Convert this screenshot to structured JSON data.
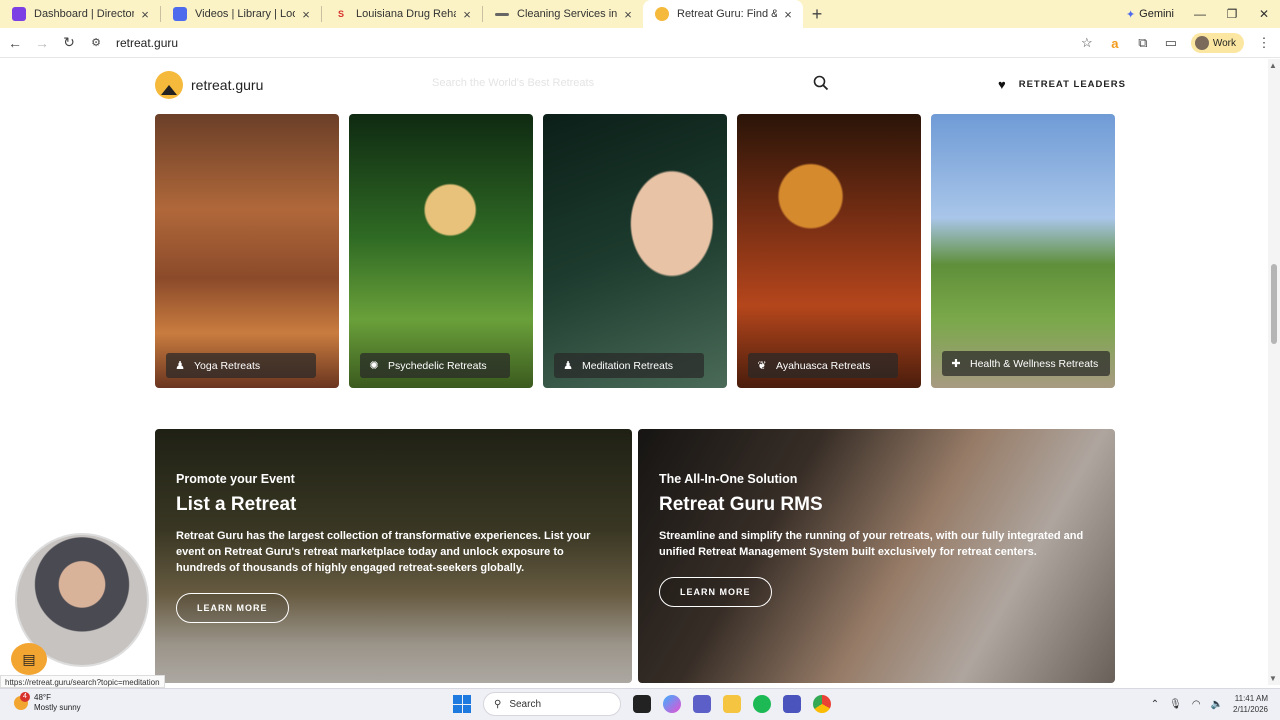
{
  "browser": {
    "tabs": [
      {
        "title": "Dashboard | Directorly App",
        "favicon_color": "#7b3fe4",
        "favicon": "",
        "active": false
      },
      {
        "title": "Videos | Library | Loom",
        "favicon_color": "#4f6bed",
        "favicon": "",
        "active": false
      },
      {
        "title": "Louisiana Drug Rehab Centers",
        "favicon_color": "#d8322d",
        "favicon": "S",
        "active": false
      },
      {
        "title": "Cleaning Services in Boulder, C",
        "favicon_color": "#666666",
        "favicon": "",
        "active": false
      },
      {
        "title": "Retreat Guru: Find & Book Top",
        "favicon_color": "#f5b93b",
        "favicon": "",
        "active": true
      }
    ],
    "gemini_label": "Gemini",
    "url": "retreat.guru",
    "profile_label": "Work",
    "status_url": "https://retreat.guru/search?topic=meditation"
  },
  "site": {
    "logo_text": "retreat.guru",
    "search_placeholder": "Search the World's Best Retreats",
    "leaders_label": "RETREAT LEADERS"
  },
  "categories": [
    {
      "label": "Yoga Retreats",
      "icon": "meditating-person-icon"
    },
    {
      "label": "Psychedelic Retreats",
      "icon": "sun-flower-icon"
    },
    {
      "label": "Meditation Retreats",
      "icon": "meditating-person-icon"
    },
    {
      "label": "Ayahuasca Retreats",
      "icon": "leaf-icon"
    },
    {
      "label": "Health & Wellness Retreats",
      "icon": "plus-cross-icon"
    }
  ],
  "promos": [
    {
      "kicker": "Promote your Event",
      "title": "List a Retreat",
      "description": "Retreat Guru has the largest collection of transformative experiences. List your event on Retreat Guru's retreat marketplace today and unlock exposure to hundreds of thousands of highly engaged retreat-seekers globally.",
      "button": "LEARN MORE"
    },
    {
      "kicker": "The All-In-One Solution",
      "title": "Retreat Guru RMS",
      "description": "Streamline and simplify the running of your retreats, with our fully integrated and unified Retreat Management System built exclusively for retreat centers.",
      "button": "LEARN MORE"
    }
  ],
  "taskbar": {
    "weather_temp": "48°F",
    "weather_desc": "Mostly sunny",
    "weather_badge": "4",
    "search_label": "Search",
    "time": "11:41 AM",
    "date": "2/11/2026"
  }
}
